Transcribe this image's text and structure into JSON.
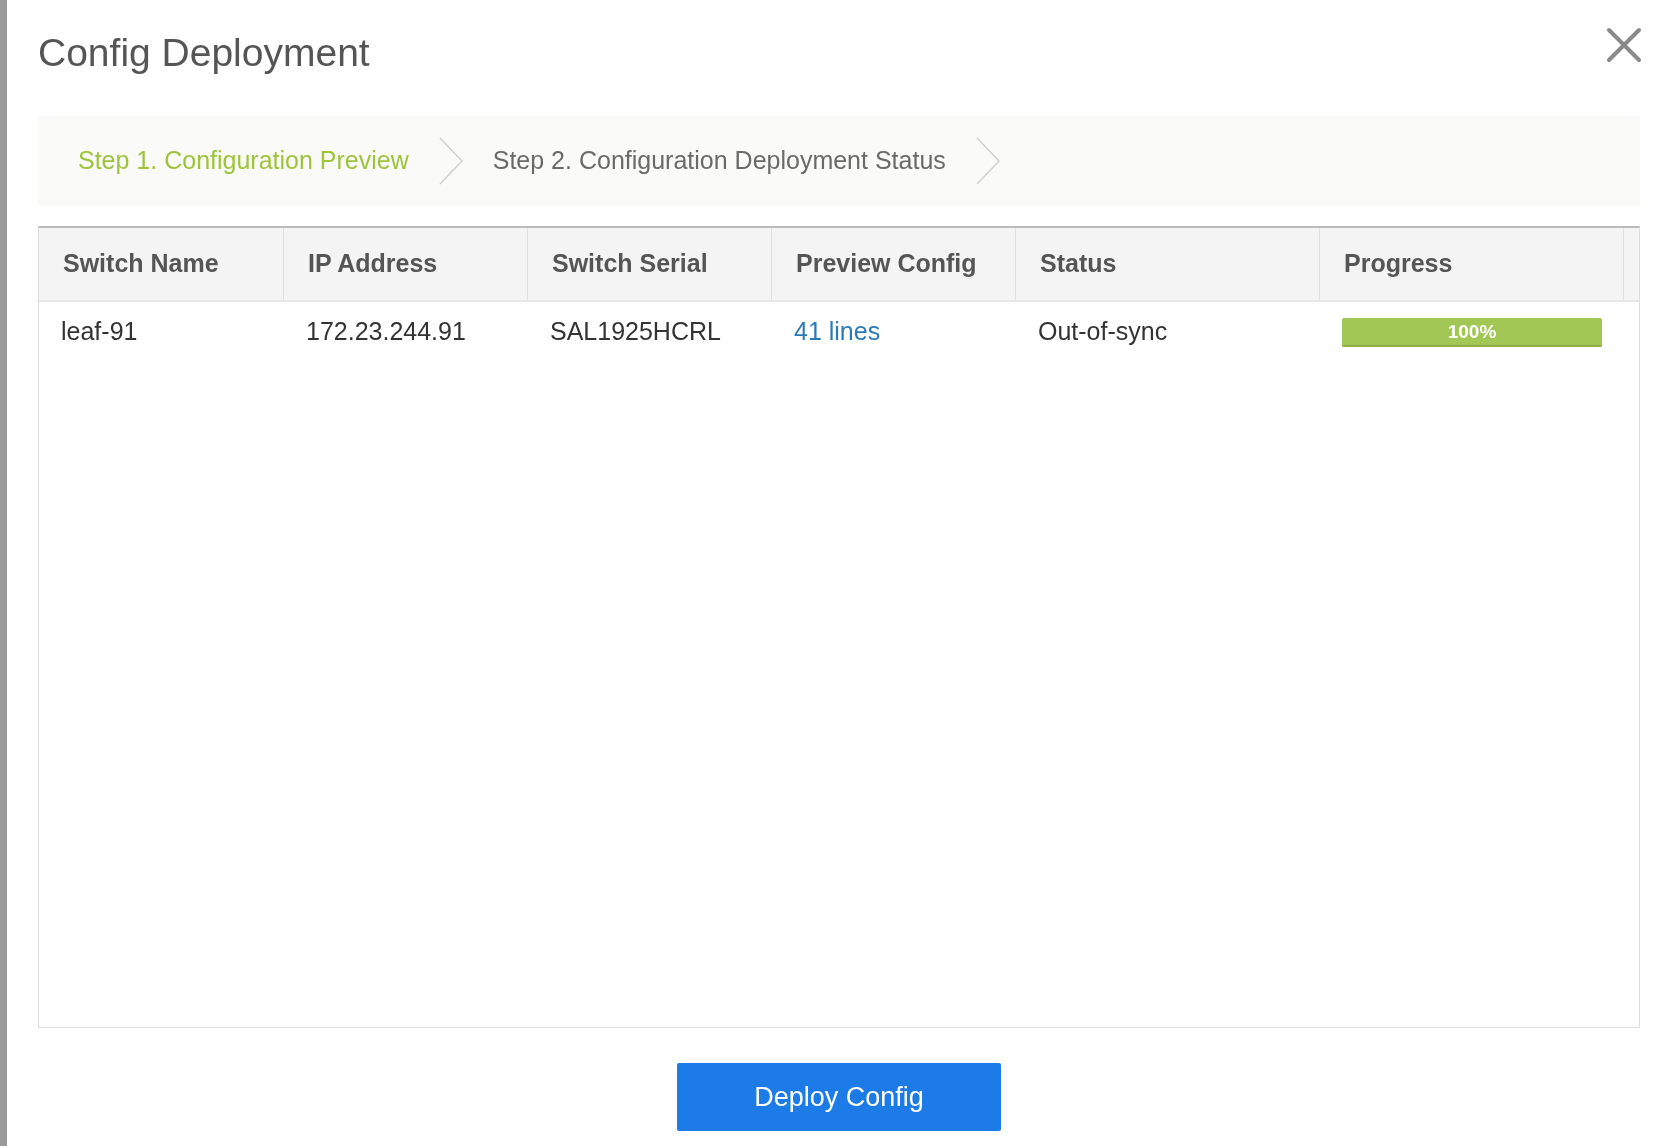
{
  "dialog": {
    "title": "Config Deployment"
  },
  "steps": [
    {
      "label": "Step 1. Configuration Preview",
      "selected": true
    },
    {
      "label": "Step 2. Configuration Deployment Status",
      "selected": false
    }
  ],
  "table": {
    "columns": [
      "Switch Name",
      "IP Address",
      "Switch Serial",
      "Preview Config",
      "Status",
      "Progress"
    ],
    "rows": [
      {
        "switch_name": "leaf-91",
        "ip_address": "172.23.244.91",
        "switch_serial": "SAL1925HCRL",
        "preview_config": "41 lines",
        "status": "Out-of-sync",
        "progress": {
          "level": 1,
          "label": "100%"
        }
      }
    ]
  },
  "buttons": [
    {
      "label": "Deploy Config"
    }
  ]
}
